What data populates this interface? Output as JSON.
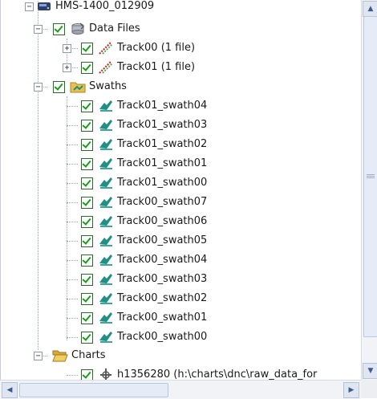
{
  "tree": {
    "root": {
      "label": "HMS-1400_012909",
      "icon": "hard-drive-icon"
    },
    "data_files": {
      "label": "Data Files",
      "icon": "data-files-icon",
      "children": [
        {
          "label": "Track00 (1 file)",
          "icon": "track-icon"
        },
        {
          "label": "Track01 (1 file)",
          "icon": "track-icon"
        }
      ]
    },
    "swaths": {
      "label": "Swaths",
      "icon": "folder-icon",
      "children": [
        {
          "label": "Track01_swath04"
        },
        {
          "label": "Track01_swath03"
        },
        {
          "label": "Track01_swath02"
        },
        {
          "label": "Track01_swath01"
        },
        {
          "label": "Track01_swath00"
        },
        {
          "label": "Track00_swath07"
        },
        {
          "label": "Track00_swath06"
        },
        {
          "label": "Track00_swath05"
        },
        {
          "label": "Track00_swath04"
        },
        {
          "label": "Track00_swath03"
        },
        {
          "label": "Track00_swath02"
        },
        {
          "label": "Track00_swath01"
        },
        {
          "label": "Track00_swath00"
        }
      ]
    },
    "charts": {
      "label": "Charts",
      "icon": "folder-open-icon",
      "children": [
        {
          "label": "h1356280 (h:\\charts\\dnc\\raw_data_for",
          "icon": "chart-icon"
        }
      ]
    }
  },
  "colors": {
    "check": "#1d9b1d",
    "swath_icon": "#1f8f86",
    "folder": "#e9c14a"
  }
}
